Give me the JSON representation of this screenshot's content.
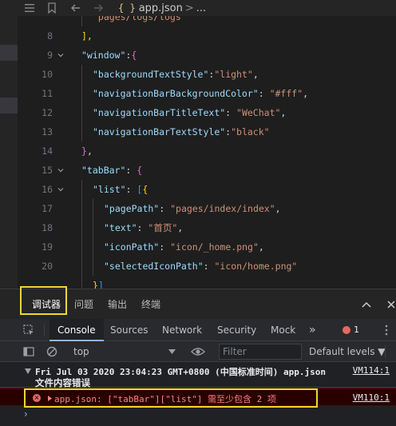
{
  "breadcrumb": {
    "file_icon": "{ }",
    "file": "app.json",
    "sep": ">",
    "rest": "..."
  },
  "editor": {
    "lines": [
      {
        "num": "",
        "indent": 2,
        "tokens": [
          {
            "t": "\"pages/logs/logs\"",
            "c": "s"
          }
        ]
      },
      {
        "num": "8",
        "indent": 1,
        "tokens": [
          {
            "t": "],",
            "c": "b3"
          }
        ]
      },
      {
        "num": "9",
        "indent": 1,
        "fold": true,
        "tokens": [
          {
            "t": "\"window\"",
            "c": "k"
          },
          {
            "t": ":",
            "c": "p"
          },
          {
            "t": "{",
            "c": "b2"
          }
        ]
      },
      {
        "num": "10",
        "indent": 2,
        "tokens": [
          {
            "t": "\"backgroundTextStyle\"",
            "c": "k"
          },
          {
            "t": ":",
            "c": "p"
          },
          {
            "t": "\"light\"",
            "c": "s"
          },
          {
            "t": ",",
            "c": "p"
          }
        ]
      },
      {
        "num": "11",
        "indent": 2,
        "tokens": [
          {
            "t": "\"navigationBarBackgroundColor\"",
            "c": "k"
          },
          {
            "t": ": ",
            "c": "p"
          },
          {
            "t": "\"#fff\"",
            "c": "s"
          },
          {
            "t": ",",
            "c": "p"
          }
        ]
      },
      {
        "num": "12",
        "indent": 2,
        "tokens": [
          {
            "t": "\"navigationBarTitleText\"",
            "c": "k"
          },
          {
            "t": ": ",
            "c": "p"
          },
          {
            "t": "\"WeChat\"",
            "c": "s"
          },
          {
            "t": ",",
            "c": "p"
          }
        ]
      },
      {
        "num": "13",
        "indent": 2,
        "tokens": [
          {
            "t": "\"navigationBarTextStyle\"",
            "c": "k"
          },
          {
            "t": ":",
            "c": "p"
          },
          {
            "t": "\"black\"",
            "c": "s"
          }
        ]
      },
      {
        "num": "14",
        "indent": 1,
        "tokens": [
          {
            "t": "}",
            "c": "b2"
          },
          {
            "t": ",",
            "c": "p"
          }
        ]
      },
      {
        "num": "15",
        "indent": 1,
        "fold": true,
        "tokens": [
          {
            "t": "\"tabBar\"",
            "c": "k"
          },
          {
            "t": ": ",
            "c": "p"
          },
          {
            "t": "{",
            "c": "b2"
          }
        ]
      },
      {
        "num": "16",
        "indent": 2,
        "fold": true,
        "tokens": [
          {
            "t": "\"list\"",
            "c": "k"
          },
          {
            "t": ": ",
            "c": "p"
          },
          {
            "t": "[",
            "c": "b4"
          },
          {
            "t": "{",
            "c": "b3"
          }
        ]
      },
      {
        "num": "17",
        "indent": 3,
        "tokens": [
          {
            "t": "\"pagePath\"",
            "c": "k"
          },
          {
            "t": ": ",
            "c": "p"
          },
          {
            "t": "\"pages/index/index\"",
            "c": "s"
          },
          {
            "t": ",",
            "c": "p"
          }
        ]
      },
      {
        "num": "18",
        "indent": 3,
        "tokens": [
          {
            "t": "\"text\"",
            "c": "k"
          },
          {
            "t": ": ",
            "c": "p"
          },
          {
            "t": "\"首页\"",
            "c": "s"
          },
          {
            "t": ",",
            "c": "p"
          }
        ]
      },
      {
        "num": "19",
        "indent": 3,
        "tokens": [
          {
            "t": "\"iconPath\"",
            "c": "k"
          },
          {
            "t": ": ",
            "c": "p"
          },
          {
            "t": "\"icon/_home.png\"",
            "c": "s"
          },
          {
            "t": ",",
            "c": "p"
          }
        ]
      },
      {
        "num": "20",
        "indent": 3,
        "tokens": [
          {
            "t": "\"selectedIconPath\"",
            "c": "k"
          },
          {
            "t": ": ",
            "c": "p"
          },
          {
            "t": "\"icon/home.png\"",
            "c": "s"
          }
        ]
      },
      {
        "num": "",
        "indent": 2,
        "tokens": [
          {
            "t": "}",
            "c": "b3"
          },
          {
            "t": "]",
            "c": "b4"
          }
        ]
      }
    ]
  },
  "panel": {
    "tabs": [
      "调试器",
      "问题",
      "输出",
      "终端"
    ],
    "active_tab": "调试器",
    "collapse_icon": "^",
    "close_icon": "×"
  },
  "devtools": {
    "tabs": [
      "Console",
      "Sources",
      "Network",
      "Security",
      "Mock"
    ],
    "more": "»",
    "error_count": "1",
    "context": "top",
    "filter_placeholder": "Filter",
    "levels": "Default levels ▼"
  },
  "console": {
    "group_time": "Fri Jul 03 2020 23:04:23 GMT+0800 (中国标准时间)  app.json",
    "group_link": "VM114:1",
    "group_sub": "文件内容错误",
    "error_text": "app.json: [\"tabBar\"][\"list\"] 需至少包含 2 项",
    "error_link": "VM110:1",
    "prompt": "›"
  },
  "colors": {
    "highlight": "#f5d533",
    "error_bg": "#290000",
    "error_text": "#ff8080"
  }
}
